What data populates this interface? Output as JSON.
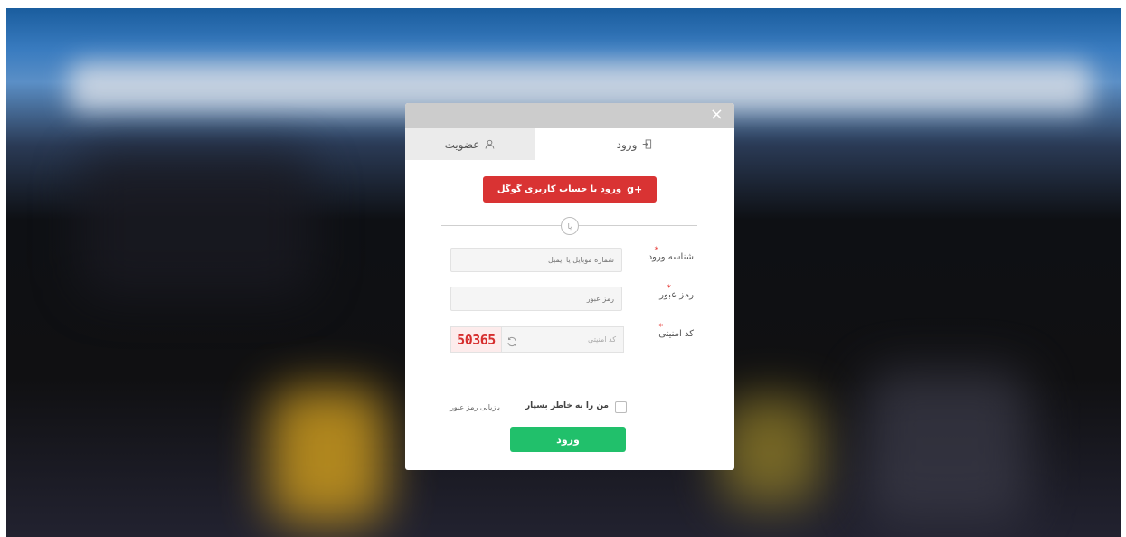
{
  "modal": {
    "close_label": "×",
    "tabs": {
      "login": "ورود",
      "register": "عضویت"
    },
    "google_button": "ورود با حساب کاربری گوگل",
    "google_icon": "g+",
    "divider_text": "یا",
    "fields": {
      "username": {
        "label": "شناسه ورود",
        "required_mark": "*",
        "placeholder": "شماره موبایل یا ایمیل"
      },
      "password": {
        "label": "رمز عبور",
        "required_mark": "*",
        "placeholder": "رمز عبور"
      },
      "captcha": {
        "label": "کد امنیتی",
        "required_mark": "*",
        "placeholder": "کد امنیتی",
        "code": "50365"
      }
    },
    "remember_me": "من را به خاطر بسپار",
    "forgot_password": "بازیابی رمز عبور",
    "submit": "ورود"
  },
  "colors": {
    "google_red": "#d93333",
    "submit_green": "#21c06b",
    "header_gray": "#cccccc",
    "required_red": "#e53935"
  },
  "icons": {
    "login_tab": "login-icon",
    "register_tab": "user-icon",
    "close": "close-icon",
    "google": "google-plus-icon",
    "captcha_refresh": "refresh-icon"
  }
}
